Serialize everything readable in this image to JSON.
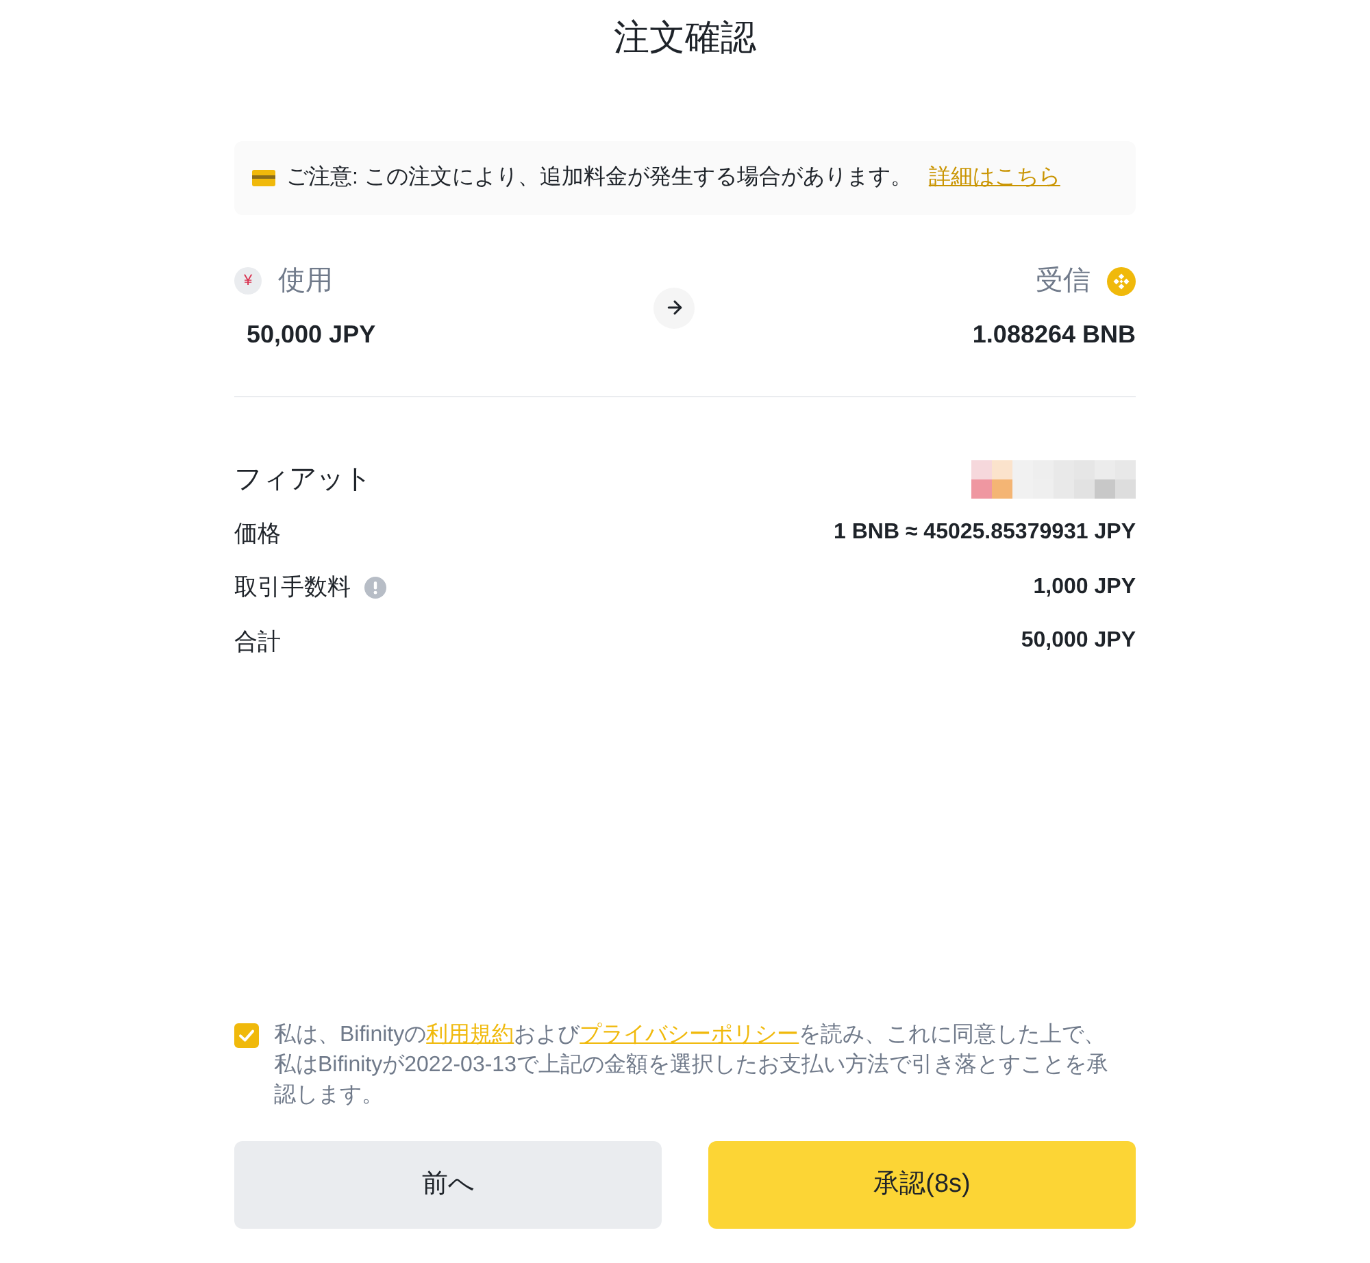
{
  "title": "注文確認",
  "notice": {
    "text": "ご注意: この注文により、追加料金が発生する場合があります。",
    "link": "詳細はこちら"
  },
  "exchange": {
    "spend": {
      "symbol": "¥",
      "label": "使用",
      "amount": "50,000 JPY"
    },
    "receive": {
      "label": "受信",
      "amount": "1.088264 BNB"
    }
  },
  "details": [
    {
      "kind": "pixelated",
      "label": "フィアット",
      "info": false
    },
    {
      "kind": "text",
      "label": "価格",
      "value": "1 BNB ≈ 45025.85379931 JPY",
      "info": false
    },
    {
      "kind": "text",
      "label": "取引手数料",
      "value": "1,000 JPY",
      "info": true
    },
    {
      "kind": "text",
      "label": "合計",
      "value": "50,000 JPY",
      "info": false
    }
  ],
  "agreement": {
    "checked": true,
    "parts": [
      {
        "kind": "text",
        "text": "私は、Bifinityの"
      },
      {
        "kind": "link",
        "text": "利用規約"
      },
      {
        "kind": "text",
        "text": "および"
      },
      {
        "kind": "link",
        "text": "プライバシーポリシー"
      },
      {
        "kind": "text",
        "text": "を読み、これに同意した上で、私はBifinityが2022-03-13で上記の金額を選択したお支払い方法で引き落とすことを承認します。"
      }
    ]
  },
  "buttons": [
    {
      "kind": "secondary",
      "label": "前へ"
    },
    {
      "kind": "primary",
      "label": "承認(8s)"
    }
  ]
}
